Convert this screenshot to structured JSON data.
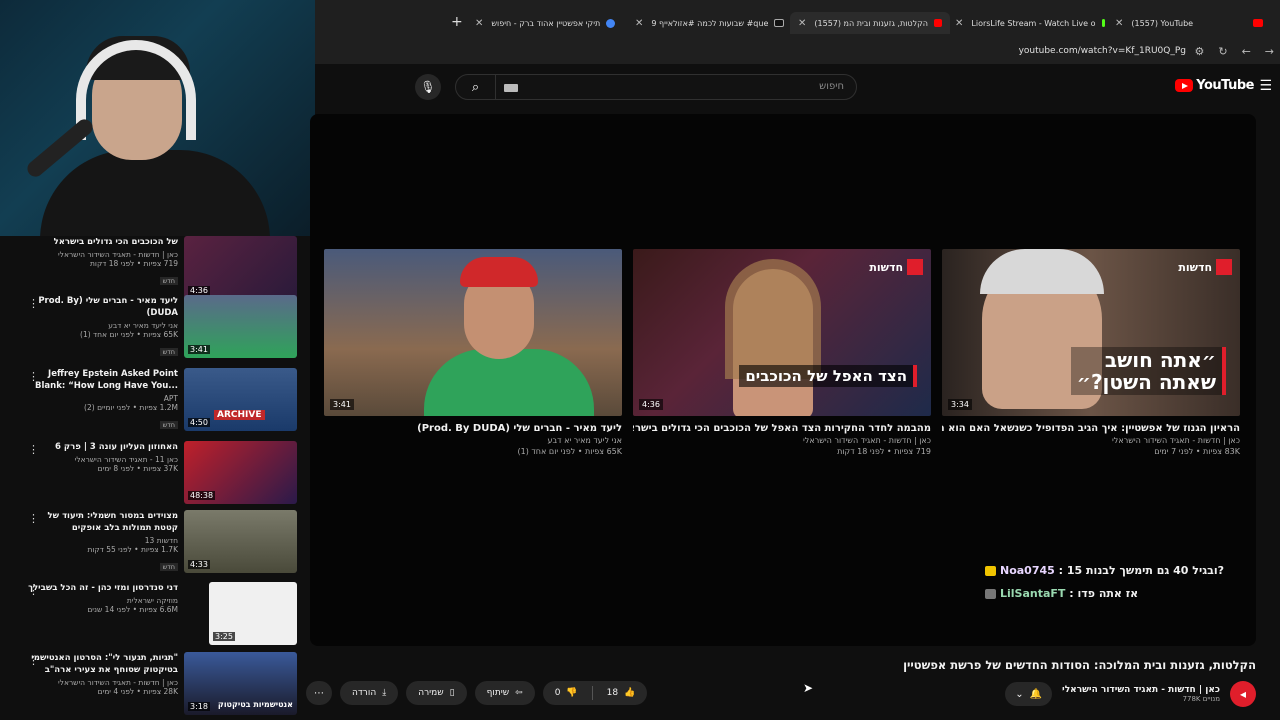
{
  "browser": {
    "tabs": [
      {
        "label": "(1557) YouTube",
        "fav": "#ff0000"
      },
      {
        "label": "LiorsLife Stream - Watch Live o",
        "fav": "#53fc18"
      },
      {
        "label": "(1557) הקלטות, גזענות ובית המ",
        "fav": "#ff0000",
        "active": true
      },
      {
        "label": "9 שבועות לכמה #אזולאייף #que",
        "fav": "#111111"
      },
      {
        "label": "תיקי אפשטיין אהוד ברק - חיפוש",
        "fav": "#4285f4"
      }
    ],
    "url": "youtube.com/watch?v=Kf_1RU0Q_Pg"
  },
  "header": {
    "logo_text": "YouTube",
    "search_placeholder": "חיפוש"
  },
  "endscreen": [
    {
      "title": "הראיון הגנוז של אפשטיין: איך הגיב הפדופיל כשנשאל האם הוא השטן?",
      "channel": "כאן | חדשות - תאגיד השידור הישראלי",
      "meta": "83K צפיות • לפני 7 ימים",
      "duration": "3:34",
      "badge": "חדשות",
      "overlay_line1": "״אתה חושב",
      "overlay_line2": "שאתה השטן?״"
    },
    {
      "title": "מהבמה לחדר החקירות הצד האפל של הכוכבים הכי גדולים בישראל",
      "channel": "כאן | חדשות - תאגיד השידור הישראלי",
      "meta": "719 צפיות • לפני 18 דקות",
      "duration": "4:36",
      "badge": "חדשות",
      "overlay_line1": "הצד האפל של הכוכבים"
    },
    {
      "title": "ליעד מאיר - חברים שלי (Prod. By DUDA)",
      "channel": "אני ליעד מאיר יא דבע",
      "meta": "65K צפיות • לפני יום אחד (1)",
      "duration": "3:41"
    }
  ],
  "chat": [
    {
      "user": "Noa0745",
      "text": ": ובגיל 40 גם תימשך לבנות 15?"
    },
    {
      "user": "LilSantaFT",
      "text": ": אז אתה פדו"
    }
  ],
  "video": {
    "title": "הקלטות, גזענות ובית המלוכה: הסודות החדשים של פרשת אפשטיין",
    "channel": "כאן | חדשות - תאגיד השידור הישראלי",
    "subs": "778K מנויים",
    "likes": "18",
    "dislikes": "0",
    "share": "שיתוף",
    "save": "שמירה",
    "download": "הורדה"
  },
  "sidebar": [
    {
      "title": "של הכוכבים הכי גדולים בישראל",
      "channel": "כאן | חדשות - תאגיד השידור הישראלי",
      "views": "719 צפיות • לפני 18 דקות",
      "new": "חדש",
      "duration": "4:36"
    },
    {
      "title": "ליעד מאיר - חברים שלי (Prod. By DUDA)",
      "channel": "אני ליעד מאיר יא דבע",
      "views": "65K צפיות • לפני יום אחד (1)",
      "new": "חדש",
      "duration": "3:41"
    },
    {
      "title": "Jeffrey Epstein Asked Point Blank: “How Long Have You...",
      "channel": "APT",
      "views": "1.2M צפיות • לפני יומיים (2)",
      "new": "חדש",
      "duration": "4:50",
      "extra": "ARCHIVE"
    },
    {
      "title": "האחוזון העליון עונה 3 | פרק 6",
      "channel": "כאן 11 - תאגיד השידור הישראלי",
      "views": "37K צפיות • לפני 8 ימים",
      "new": "",
      "duration": "48:38"
    },
    {
      "title": "מצוידים במסור חשמלי: תיעוד של קטטת תמולות בלב אופקים",
      "channel": "חדשות 13",
      "views": "1.7K צפיות • לפני 55 דקות",
      "new": "חדש",
      "duration": "4:33"
    },
    {
      "title": "דני סנדרסון ומזי כהן - זה הכל בשבילך",
      "channel": "מוזיקה ישראלית",
      "views": "6.6M צפיות • לפני 14 שנים",
      "new": "",
      "duration": "3:25"
    },
    {
      "title": "\"תגיות, תגעור לי\": הסרטון האנטישמי בטיקטוק שסוחף את צעירי ארה\"ב",
      "channel": "כאן | חדשות - תאגיד השידור הישראלי",
      "views": "28K צפיות • לפני 4 ימים",
      "new": "",
      "duration": "3:18",
      "extra": "אנטישמיות בטיקטוק"
    }
  ],
  "colors": {
    "accent": "#ff0000",
    "kan_red": "#e01e2b",
    "bg": "#0f0f0f"
  }
}
